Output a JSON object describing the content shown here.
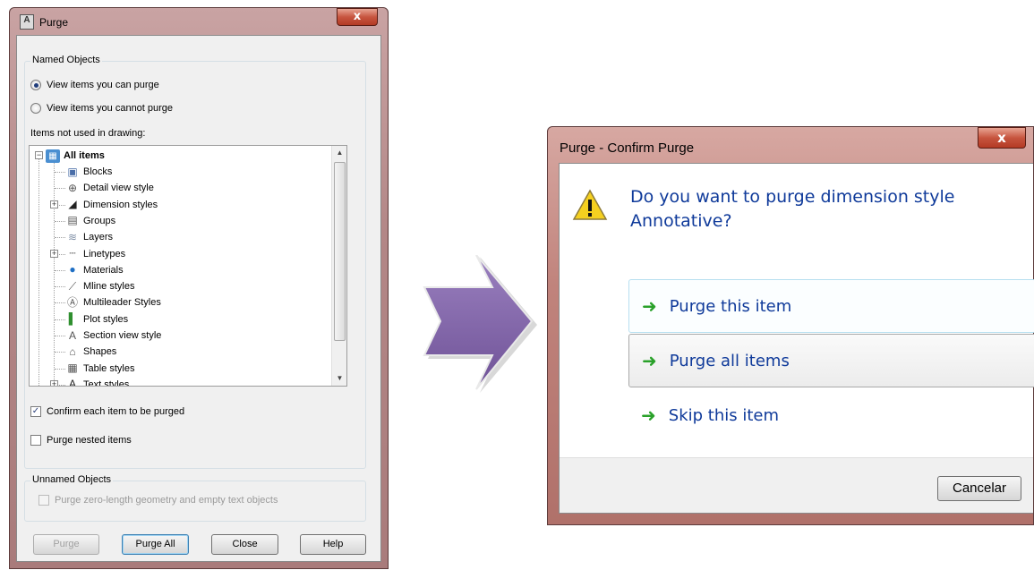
{
  "purge_dialog": {
    "title": "Purge",
    "app_icon_text": "A",
    "close_glyph": "x",
    "named_objects": {
      "label": "Named Objects",
      "radio_can_purge": "View items you can purge",
      "radio_cannot_purge": "View items you cannot purge",
      "list_label": "Items not used in drawing:",
      "tree": {
        "root": "All items",
        "items": [
          {
            "label": "Blocks",
            "icon": "blocks-icon",
            "expandable": false
          },
          {
            "label": "Detail view style",
            "icon": "detail-view-style-icon",
            "expandable": false
          },
          {
            "label": "Dimension styles",
            "icon": "dimension-styles-icon",
            "expandable": true
          },
          {
            "label": "Groups",
            "icon": "groups-icon",
            "expandable": false
          },
          {
            "label": "Layers",
            "icon": "layers-icon",
            "expandable": false
          },
          {
            "label": "Linetypes",
            "icon": "linetypes-icon",
            "expandable": true
          },
          {
            "label": "Materials",
            "icon": "materials-icon",
            "expandable": false
          },
          {
            "label": "Mline styles",
            "icon": "mline-styles-icon",
            "expandable": false
          },
          {
            "label": "Multileader Styles",
            "icon": "multileader-styles-icon",
            "expandable": false
          },
          {
            "label": "Plot styles",
            "icon": "plot-styles-icon",
            "expandable": false
          },
          {
            "label": "Section view style",
            "icon": "section-view-style-icon",
            "expandable": false
          },
          {
            "label": "Shapes",
            "icon": "shapes-icon",
            "expandable": false
          },
          {
            "label": "Table styles",
            "icon": "table-styles-icon",
            "expandable": false
          },
          {
            "label": "Text styles",
            "icon": "text-styles-icon",
            "expandable": true
          }
        ]
      },
      "confirm_each": "Confirm each item to be purged",
      "confirm_each_checked": true,
      "purge_nested": "Purge nested items",
      "purge_nested_checked": false
    },
    "unnamed_objects": {
      "label": "Unnamed Objects",
      "zero_length": "Purge zero-length geometry and empty text objects",
      "zero_length_checked": false
    },
    "buttons": {
      "purge": "Purge",
      "purge_all": "Purge All",
      "close": "Close",
      "help": "Help"
    }
  },
  "confirm_dialog": {
    "title": "Purge - Confirm Purge",
    "close_glyph": "x",
    "question": "Do you want to purge dimension style Annotative?",
    "options": {
      "purge_this": "Purge this item",
      "purge_all": "Purge all items",
      "skip": "Skip this item"
    },
    "cancel": "Cancelar"
  },
  "colors": {
    "arrow": "#8468a8",
    "link_text": "#0f3a9a",
    "green_arrow": "#2aa12a"
  }
}
